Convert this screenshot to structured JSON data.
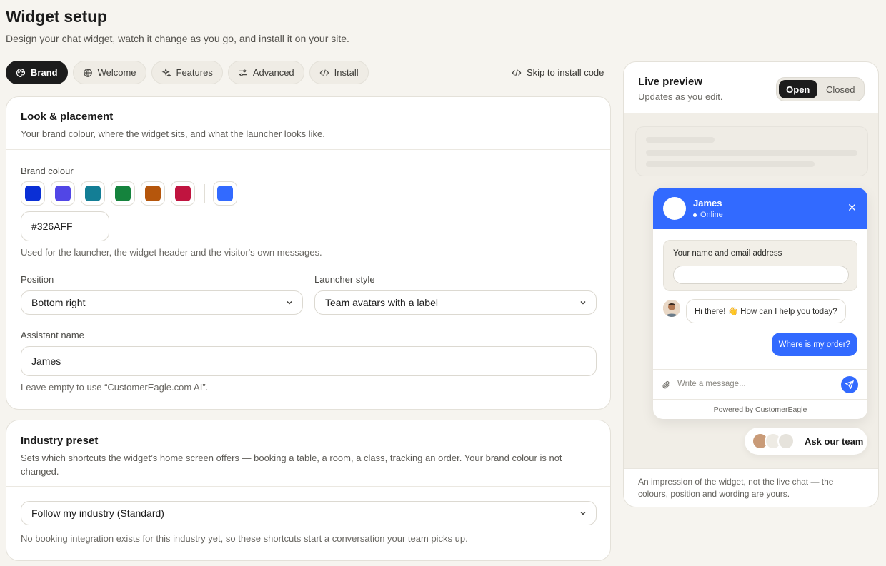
{
  "page": {
    "title": "Widget setup",
    "subtitle": "Design your chat widget, watch it change as you go, and install it on your site."
  },
  "tabs": [
    {
      "label": "Brand",
      "icon": "palette-icon",
      "active": true
    },
    {
      "label": "Welcome",
      "icon": "globe-icon",
      "active": false
    },
    {
      "label": "Features",
      "icon": "sparkles-icon",
      "active": false
    },
    {
      "label": "Advanced",
      "icon": "sliders-icon",
      "active": false
    },
    {
      "label": "Install",
      "icon": "code-icon",
      "active": false
    }
  ],
  "skip_link": {
    "label": "Skip to install code",
    "icon": "code-icon"
  },
  "look": {
    "title": "Look & placement",
    "description": "Your brand colour, where the widget sits, and what the launcher looks like.",
    "brand_colour_label": "Brand colour",
    "swatches": [
      "#0a2fd6",
      "#5146e6",
      "#137e95",
      "#15833d",
      "#b5560c",
      "#c0143f"
    ],
    "custom_colour": "#326AFF",
    "hex_value": "#326AFF",
    "brand_help": "Used for the launcher, the widget header and the visitor's own messages.",
    "position_label": "Position",
    "position_value": "Bottom right",
    "launcher_label": "Launcher style",
    "launcher_value": "Team avatars with a label",
    "assistant_label": "Assistant name",
    "assistant_value": "James",
    "assistant_help": "Leave empty to use “CustomerEagle.com AI”."
  },
  "industry": {
    "title": "Industry preset",
    "description": "Sets which shortcuts the widget’s home screen offers — booking a table, a room, a class, tracking an order. Your brand colour is not changed.",
    "select_value": "Follow my industry (Standard)",
    "help": "No booking integration exists for this industry yet, so these shortcuts start a conversation your team picks up."
  },
  "preview": {
    "title": "Live preview",
    "subtitle": "Updates as you edit.",
    "toggle_open": "Open",
    "toggle_closed": "Closed",
    "widget_name": "James",
    "widget_status": "Online",
    "name_card_label": "Your name and email address",
    "agent_message": "Hi there! 👋 How can I help you today?",
    "visitor_message": "Where is my order?",
    "message_placeholder": "Write a message...",
    "powered_by": "Powered by CustomerEagle",
    "launcher_label": "Ask our team",
    "footer_note": "An impression of the widget, not the live chat — the colours, position and wording are yours."
  }
}
